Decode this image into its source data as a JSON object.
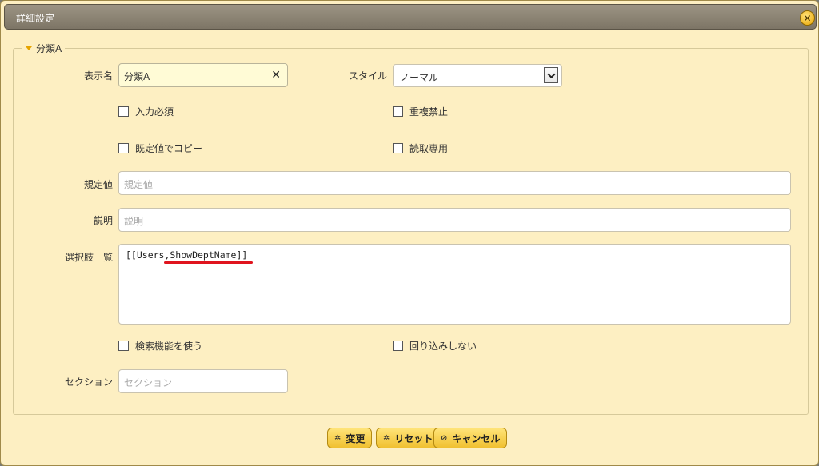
{
  "dialog": {
    "title": "詳細設定",
    "close_icon": "close-icon"
  },
  "section": {
    "legend": "分類A"
  },
  "fields": {
    "display_name": {
      "label": "表示名",
      "value": "分類A"
    },
    "style": {
      "label": "スタイル",
      "selected": "ノーマル"
    },
    "default_value": {
      "label": "規定値",
      "placeholder": "規定値"
    },
    "description": {
      "label": "説明",
      "placeholder": "説明"
    },
    "choices": {
      "label": "選択肢一覧",
      "value": "[[Users,ShowDeptName]]"
    },
    "section_field": {
      "label": "セクション",
      "placeholder": "セクション"
    }
  },
  "checkboxes": {
    "required": "入力必須",
    "no_duplicates": "重複禁止",
    "copy_default": "既定値でコピー",
    "read_only": "読取専用",
    "use_search": "検索機能を使う",
    "no_wrap": "回り込みしない"
  },
  "buttons": {
    "change": "変更",
    "reset": "リセット",
    "cancel": "キャンセル"
  },
  "colors": {
    "dialog_bg": "#fdefc2",
    "titlebar": "#8a8273",
    "button": "#f5cf45",
    "annotation_underline": "#e0141e"
  }
}
